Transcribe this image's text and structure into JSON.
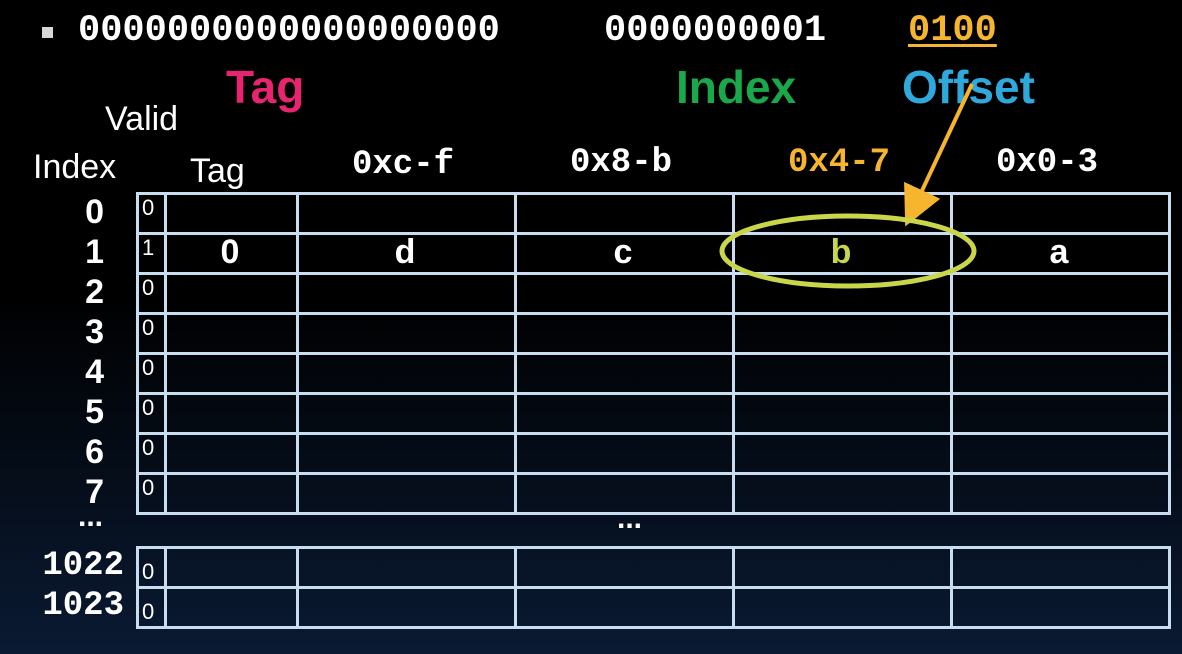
{
  "address": {
    "tag_bits": "0000000000000000000",
    "index_bits": "0000000001",
    "offset_bits": "0100"
  },
  "field_labels": {
    "tag": "Tag",
    "index": "Index",
    "offset": "Offset"
  },
  "headers": {
    "valid": "Valid",
    "index": "Index",
    "tag": "Tag",
    "col_c_f": "0xc-f",
    "col_8_b": "0x8-b",
    "col_4_7": "0x4-7",
    "col_0_3": "0x0-3"
  },
  "rows": [
    {
      "index": "0",
      "valid": "0",
      "tag": "",
      "w3": "",
      "w2": "",
      "w1": "",
      "w0": ""
    },
    {
      "index": "1",
      "valid": "1",
      "tag": "0",
      "w3": "d",
      "w2": "c",
      "w1": "b",
      "w0": "a"
    },
    {
      "index": "2",
      "valid": "0",
      "tag": "",
      "w3": "",
      "w2": "",
      "w1": "",
      "w0": ""
    },
    {
      "index": "3",
      "valid": "0",
      "tag": "",
      "w3": "",
      "w2": "",
      "w1": "",
      "w0": ""
    },
    {
      "index": "4",
      "valid": "0",
      "tag": "",
      "w3": "",
      "w2": "",
      "w1": "",
      "w0": ""
    },
    {
      "index": "5",
      "valid": "0",
      "tag": "",
      "w3": "",
      "w2": "",
      "w1": "",
      "w0": ""
    },
    {
      "index": "6",
      "valid": "0",
      "tag": "",
      "w3": "",
      "w2": "",
      "w1": "",
      "w0": ""
    },
    {
      "index": "7",
      "valid": "0",
      "tag": "",
      "w3": "",
      "w2": "",
      "w1": "",
      "w0": ""
    }
  ],
  "ellipsis_left": "...",
  "ellipsis_mid": "...",
  "bottom_rows": [
    {
      "index": "1022",
      "valid": "0"
    },
    {
      "index": "1023",
      "valid": "0"
    }
  ],
  "colors": {
    "tag": "#e8236f",
    "index": "#19a84a",
    "offset": "#2fa9dc",
    "highlight": "#f5b52e",
    "ellipse": "#c9d64a",
    "grid": "#c8ddf0"
  }
}
